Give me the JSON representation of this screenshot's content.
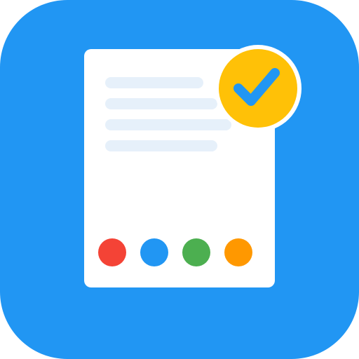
{
  "icon": {
    "name": "checklist-app-icon",
    "colors": {
      "background": "#2196F3",
      "page": "#FFFFFF",
      "text_lines": "#E6F0FA",
      "badge": "#FFC107",
      "badge_ring": "#FFFFFF",
      "checkmark": "#2196F3"
    },
    "document": {
      "text_line_count": 4,
      "color_dots": [
        {
          "name": "red-dot",
          "color": "#F44336"
        },
        {
          "name": "blue-dot",
          "color": "#2196F3"
        },
        {
          "name": "green-dot",
          "color": "#4CAF50"
        },
        {
          "name": "orange-dot",
          "color": "#FF9800"
        }
      ]
    },
    "badge_icon": "checkmark-icon"
  }
}
